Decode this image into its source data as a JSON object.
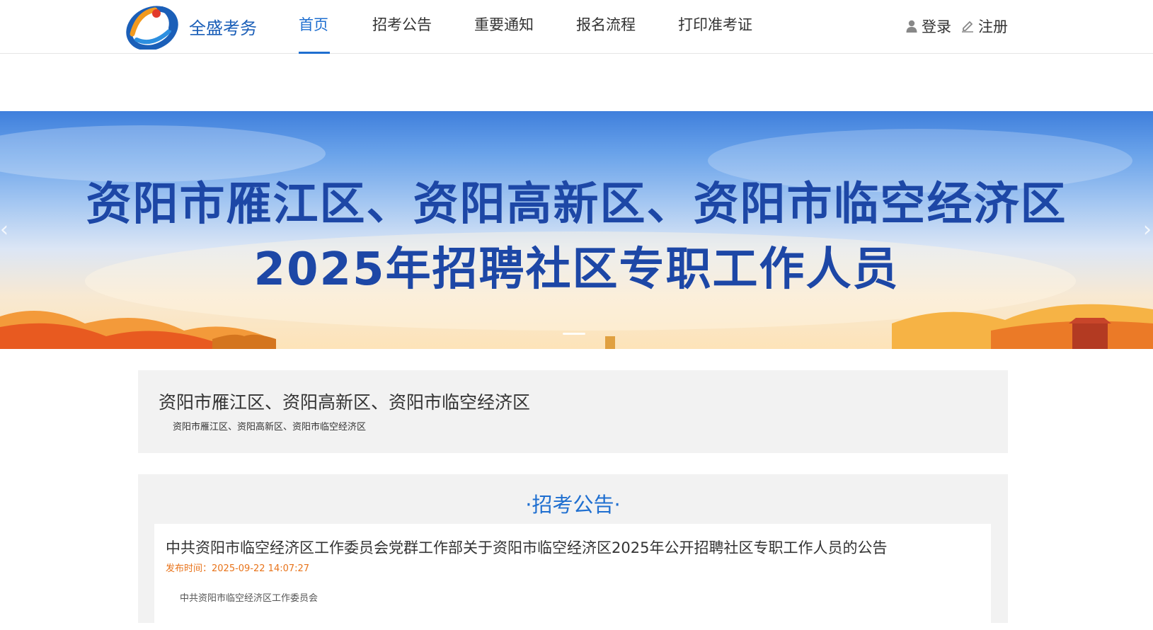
{
  "header": {
    "brand": "全盛考务",
    "nav": [
      {
        "label": "首页",
        "active": true
      },
      {
        "label": "招考公告",
        "active": false
      },
      {
        "label": "重要通知",
        "active": false
      },
      {
        "label": "报名流程",
        "active": false
      },
      {
        "label": "打印准考证",
        "active": false
      }
    ],
    "login_label": "登录",
    "register_label": "注册"
  },
  "banner": {
    "line1": "资阳市雁江区、资阳高新区、资阳市临空经济区",
    "line2": "2025年招聘社区专职工作人员",
    "prev_icon": "chevron-left-icon",
    "next_icon": "chevron-right-icon"
  },
  "org": {
    "title": "资阳市雁江区、资阳高新区、资阳市临空经济区",
    "subtitle": "资阳市雁江区、资阳高新区、资阳市临空经济区"
  },
  "announcements": {
    "heading": "·招考公告·",
    "items": [
      {
        "title": "中共资阳市临空经济区工作委员会党群工作部关于资阳市临空经济区2025年公开招聘社区专职工作人员的公告",
        "date": "发布时间：2025-09-22 14:07:27",
        "org": "中共资阳市临空经济区工作委员会"
      }
    ]
  },
  "colors": {
    "accent": "#1f6fd0",
    "brand": "#1b5fb8",
    "banner_text": "#1d47a6",
    "date": "#e8731a",
    "panel_bg": "#f2f2f2"
  }
}
